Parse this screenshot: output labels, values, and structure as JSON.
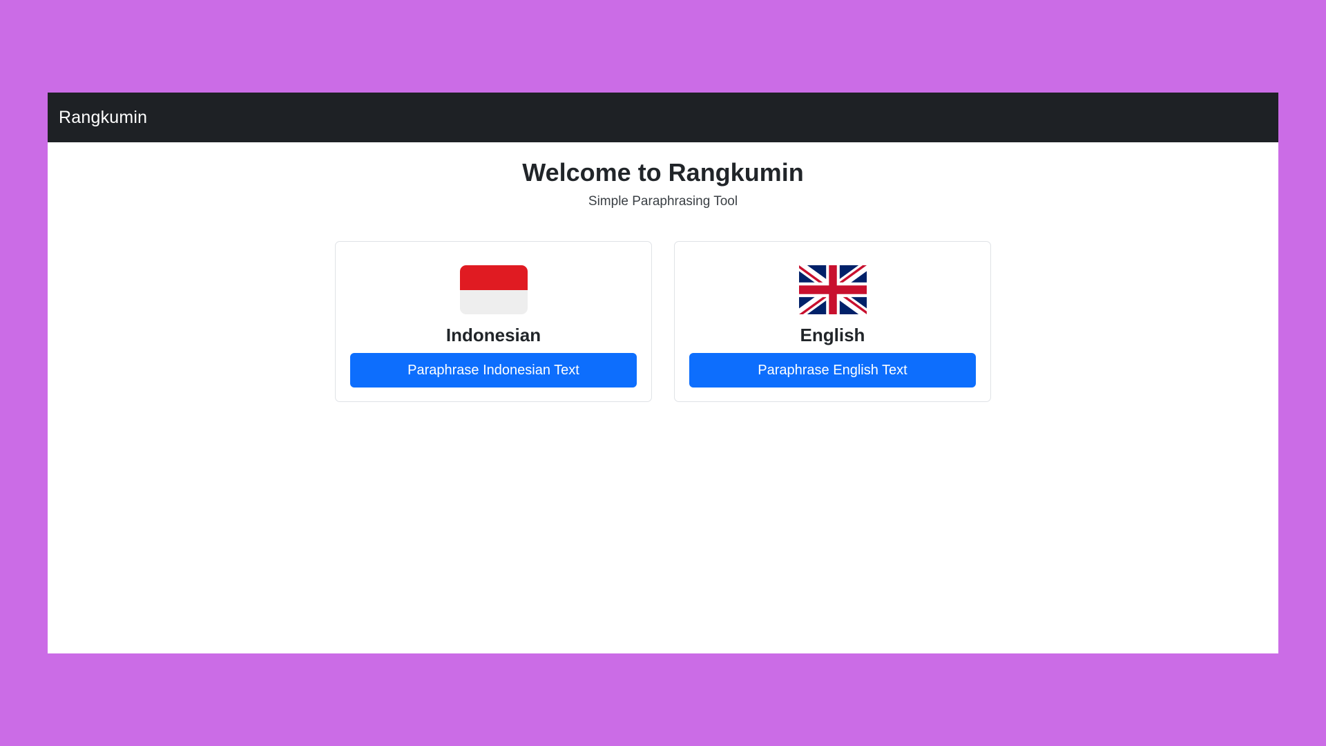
{
  "navbar": {
    "brand": "Rangkumin"
  },
  "hero": {
    "title": "Welcome to Rangkumin",
    "subtitle": "Simple Paraphrasing Tool"
  },
  "cards": [
    {
      "flag_icon": "indonesia-flag-icon",
      "language": "Indonesian",
      "button_label": "Paraphrase Indonesian Text"
    },
    {
      "flag_icon": "uk-flag-icon",
      "language": "English",
      "button_label": "Paraphrase English Text"
    }
  ],
  "colors": {
    "page_background": "#cb6ce6",
    "navbar_background": "#1e2125",
    "button_primary": "#0d6efd",
    "indonesia_red": "#e01b22",
    "indonesia_white": "#eeeeee",
    "uk_blue": "#012169",
    "uk_red": "#c8102e"
  }
}
